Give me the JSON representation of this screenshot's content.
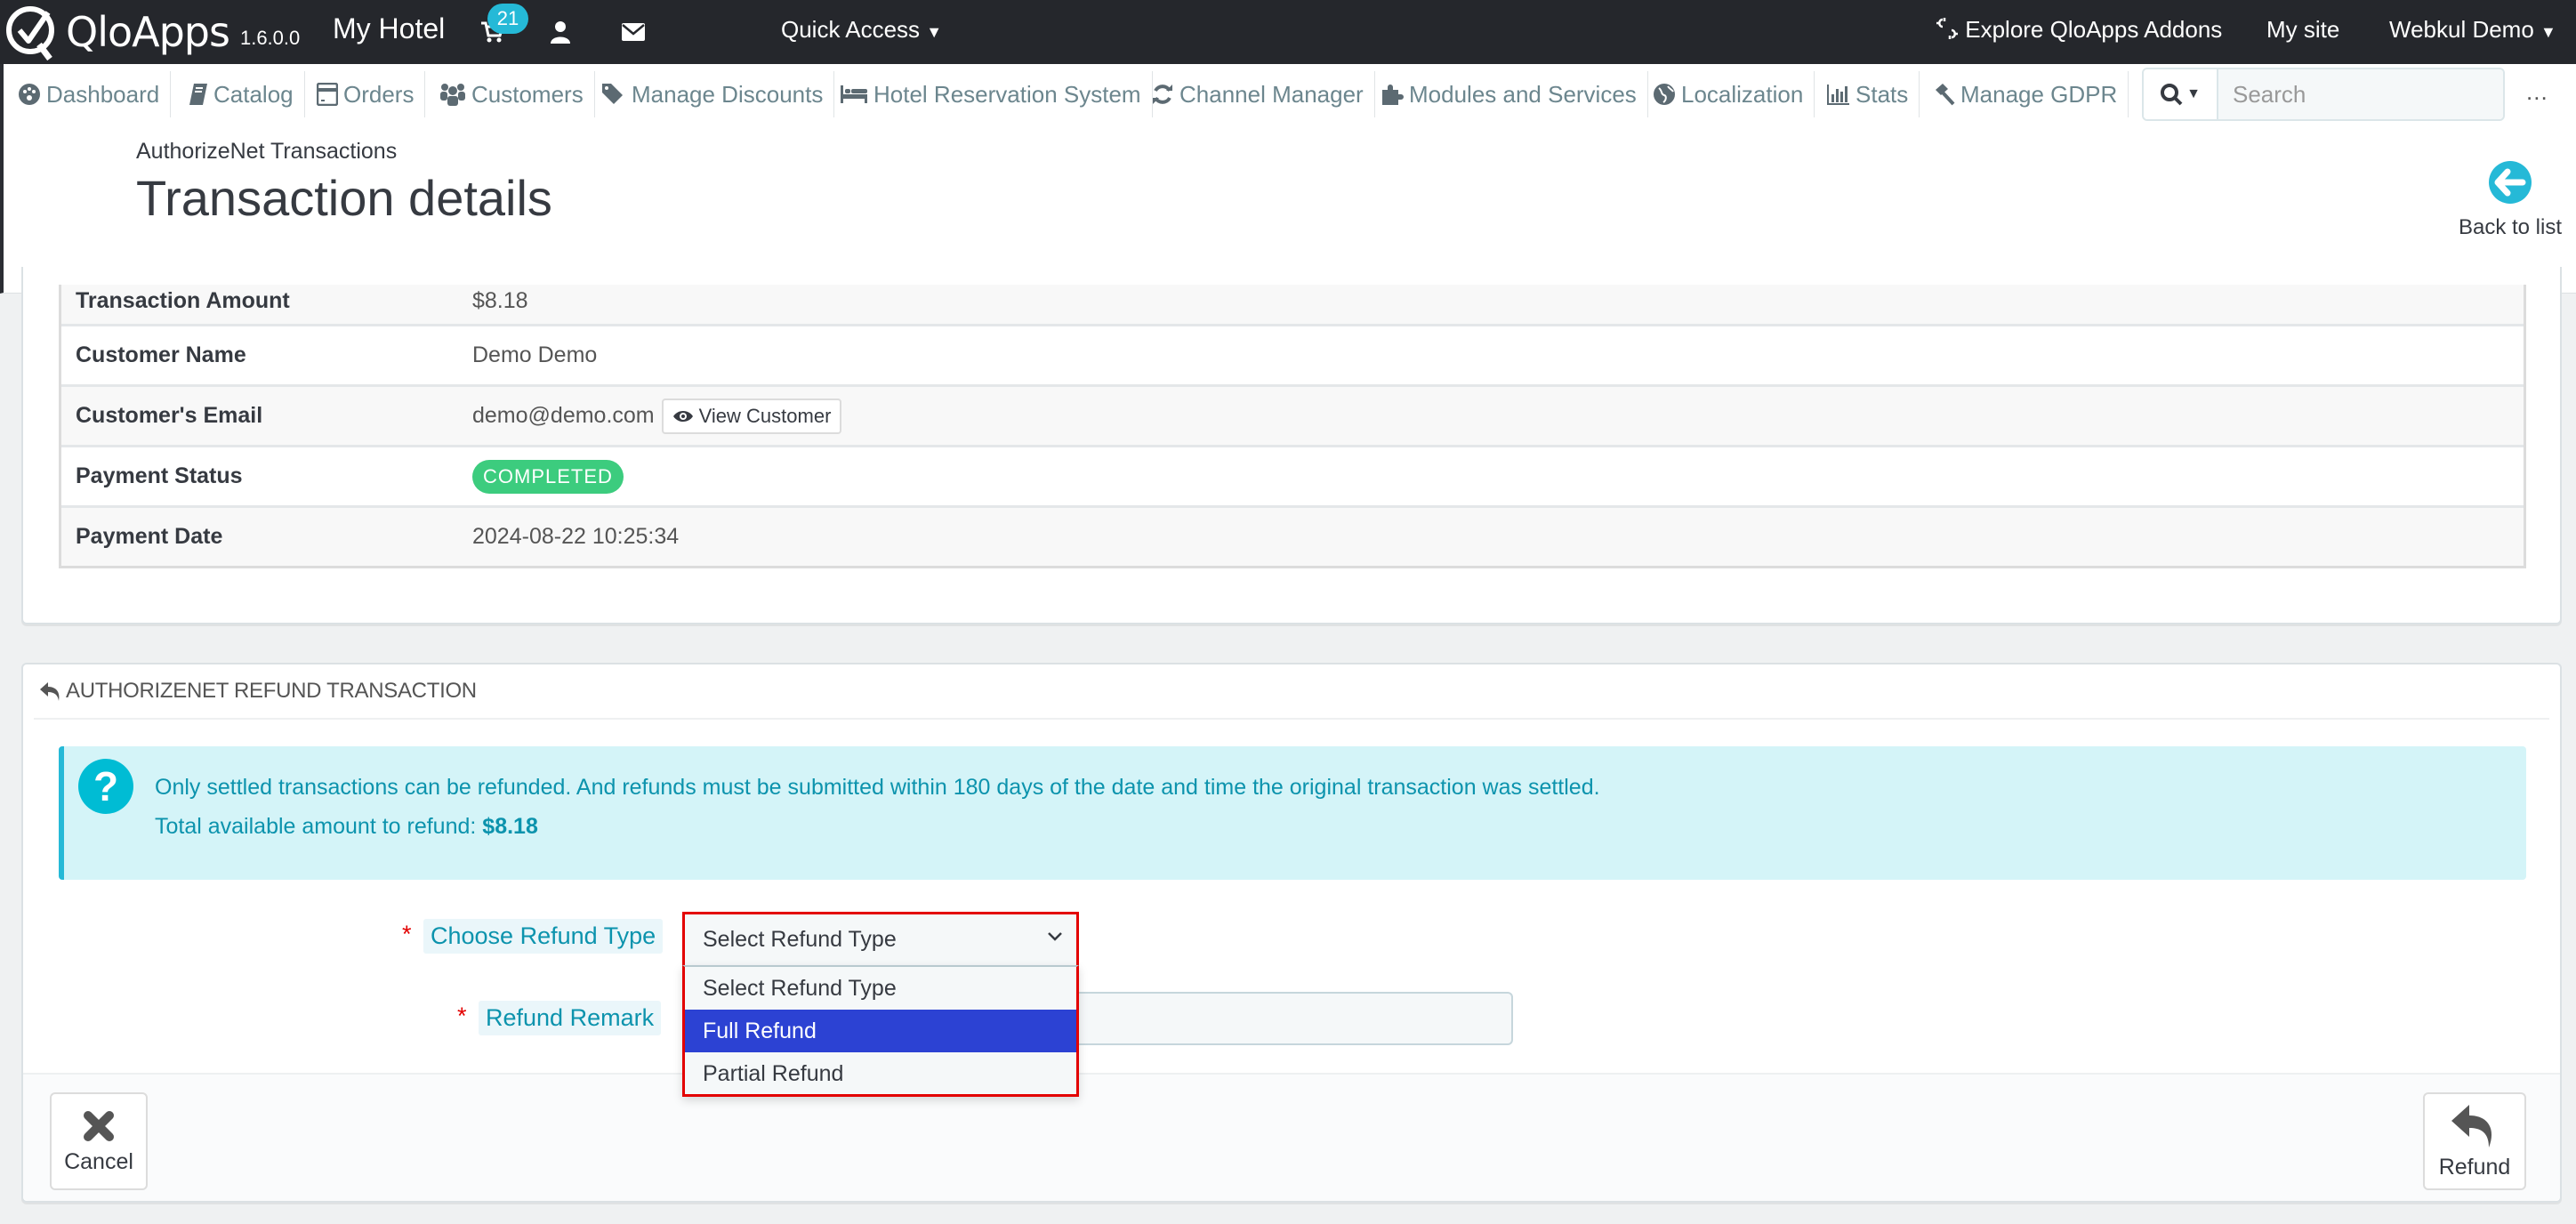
{
  "topbar": {
    "logo_text": "QloApps",
    "version": "1.6.0.0",
    "shop_name": "My Hotel",
    "cart_badge": "21",
    "quick_access": "Quick Access",
    "addons": "Explore QloApps Addons",
    "my_site": "My site",
    "user": "Webkul Demo"
  },
  "nav": {
    "items": [
      {
        "label": "Dashboard",
        "icon": "dashboard-icon"
      },
      {
        "label": "Catalog",
        "icon": "book-icon"
      },
      {
        "label": "Orders",
        "icon": "credit-card-icon"
      },
      {
        "label": "Customers",
        "icon": "users-icon"
      },
      {
        "label": "Manage Discounts",
        "icon": "tags-icon"
      },
      {
        "label": "Hotel Reservation System",
        "icon": "bed-icon"
      },
      {
        "label": "Channel Manager",
        "icon": "refresh-icon"
      },
      {
        "label": "Modules and Services",
        "icon": "puzzle-icon"
      },
      {
        "label": "Localization",
        "icon": "globe-icon"
      },
      {
        "label": "Stats",
        "icon": "bar-chart-icon"
      },
      {
        "label": "Manage GDPR",
        "icon": "gavel-icon"
      }
    ],
    "search_placeholder": "Search",
    "more": "..."
  },
  "header": {
    "breadcrumb": "AuthorizeNet Transactions",
    "title": "Transaction details",
    "back_label": "Back to list"
  },
  "details": {
    "rows": [
      {
        "label": "Transaction Amount",
        "value": "$8.18"
      },
      {
        "label": "Customer Name",
        "value": "Demo Demo"
      },
      {
        "label": "Customer's Email",
        "value": "demo@demo.com"
      },
      {
        "label": "Payment Status",
        "value": "COMPLETED"
      },
      {
        "label": "Payment Date",
        "value": "2024-08-22 10:25:34"
      }
    ],
    "view_customer": "View Customer",
    "status_color": "#3ccc7e"
  },
  "refund": {
    "heading": "AuthorizeNet Refund Transaction",
    "alert_line1": "Only settled transactions can be refunded. And refunds must be submitted within 180 days of the date and time the original transaction was settled.",
    "alert_line2_prefix": "Total available amount to refund: ",
    "alert_amount": "$8.18",
    "type_label": "Choose Refund Type",
    "type_selected": "Select Refund Type",
    "type_options": [
      "Select Refund Type",
      "Full Refund",
      "Partial Refund"
    ],
    "type_highlighted": "Full Refund",
    "remark_label": "Refund Remark",
    "remark_value": "",
    "required_mark": "*",
    "cancel_label": "Cancel",
    "submit_label": "Refund"
  },
  "colors": {
    "topbar": "#25272c",
    "accent": "#25b9d7",
    "info_text": "#0c93ad",
    "option_highlight": "#2c42d3",
    "error_border": "#e30000"
  }
}
